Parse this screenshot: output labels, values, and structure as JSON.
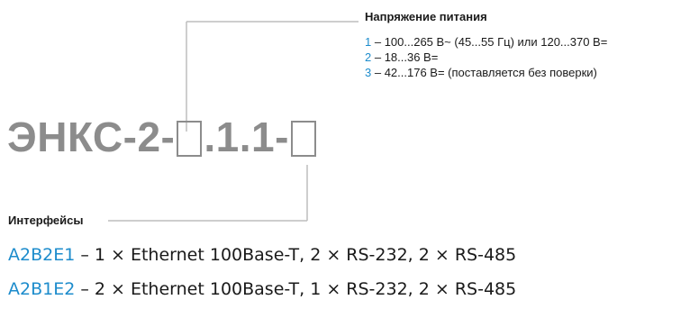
{
  "title_parts": [
    "ЭНКС-2-",
    ".1.1-"
  ],
  "power": {
    "heading": "Напряжение питания",
    "options": [
      {
        "code": "1",
        "text": " – 100...265 В~ (45...55 Гц) или 120...370 В="
      },
      {
        "code": "2",
        "text": " – 18...36 В="
      },
      {
        "code": "3",
        "text": " – 42...176 В= (поставляется без поверки)"
      }
    ]
  },
  "interfaces": {
    "heading": "Интерфейсы",
    "options": [
      {
        "code": "A2B2E1",
        "text": " – 1 × Ethernet 100Base-T, 2 × RS-232, 2 × RS-485"
      },
      {
        "code": "A2B1E2",
        "text": " – 2 × Ethernet 100Base-T, 1 × RS-232, 2 × RS-485"
      }
    ]
  },
  "colors": {
    "accent": "#1d8ccc",
    "title": "#8c8c8c",
    "line": "#bdbdbd"
  }
}
